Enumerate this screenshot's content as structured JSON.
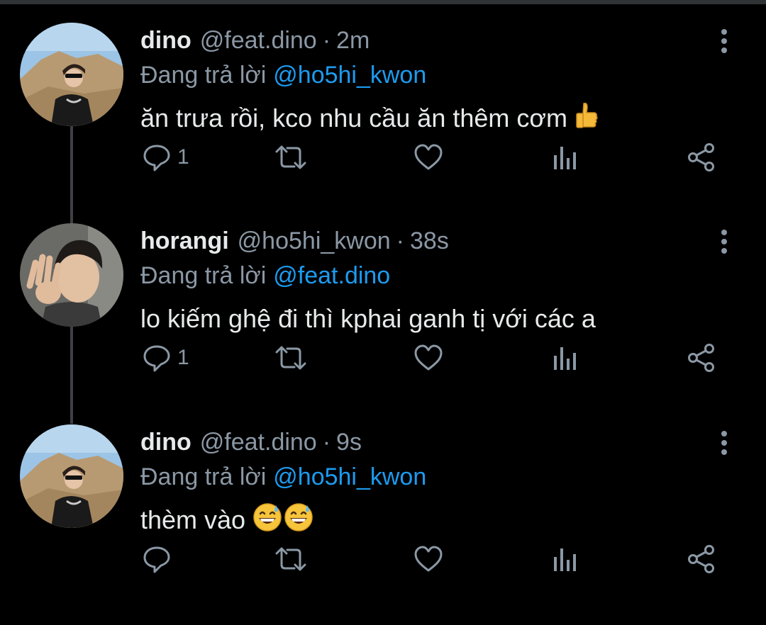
{
  "colors": {
    "background": "#000000",
    "text": "#e7e9ea",
    "muted": "#8b98a5",
    "link": "#1d9bf0",
    "thread_line": "#3e4144"
  },
  "replying_prefix": "Đang trả lời",
  "tweets": [
    {
      "name": "dino",
      "handle": "@feat.dino",
      "dot": "·",
      "time": "2m",
      "reply_to": "@ho5hi_kwon",
      "text": "ăn trưa rồi, kco nhu cầu ăn thêm cơm",
      "emoji": "thumbs-up",
      "reply_count": "1",
      "avatar": "avatar-dino"
    },
    {
      "name": "horangi",
      "handle": "@ho5hi_kwon",
      "dot": "·",
      "time": "38s",
      "reply_to": "@feat.dino",
      "text": "lo kiếm ghệ đi thì kphai ganh tị với các a",
      "emoji": "",
      "reply_count": "1",
      "avatar": "avatar-horangi"
    },
    {
      "name": "dino",
      "handle": "@feat.dino",
      "dot": "·",
      "time": "9s",
      "reply_to": "@ho5hi_kwon",
      "text": "thèm vào",
      "emoji": "grinning-sweat x2",
      "reply_count": "",
      "avatar": "avatar-dino"
    }
  ],
  "icons": {
    "reply": "reply-icon",
    "retweet": "retweet-icon",
    "like": "heart-icon",
    "views": "analytics-icon",
    "share": "share-icon",
    "more": "more-icon"
  }
}
